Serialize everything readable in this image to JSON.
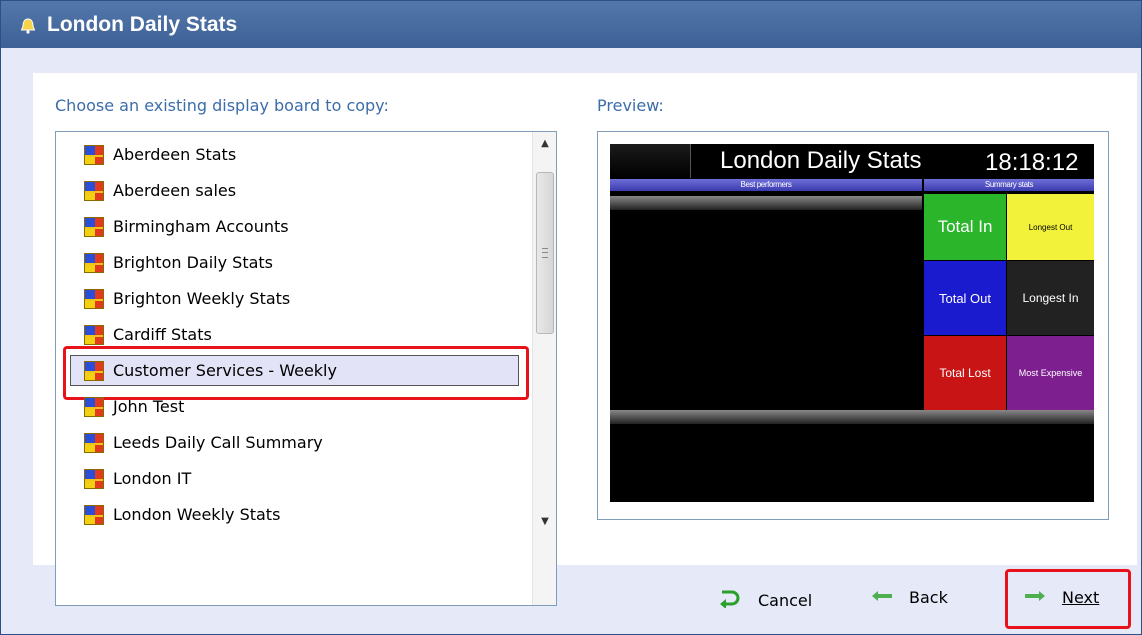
{
  "window": {
    "title": "London Daily Stats"
  },
  "copy_label": "Choose an existing display board to copy:",
  "preview_label": "Preview:",
  "boards": [
    {
      "label": "Aberdeen Stats"
    },
    {
      "label": "Aberdeen sales"
    },
    {
      "label": "Birmingham Accounts"
    },
    {
      "label": "Brighton Daily Stats"
    },
    {
      "label": "Brighton Weekly Stats"
    },
    {
      "label": "Cardiff Stats"
    },
    {
      "label": "Customer Services - Weekly"
    },
    {
      "label": "John Test"
    },
    {
      "label": "Leeds Daily Call Summary"
    },
    {
      "label": "London IT"
    },
    {
      "label": "London Weekly Stats"
    }
  ],
  "selected_board": "Customer Services - Weekly",
  "preview": {
    "title": "London Daily Stats",
    "clock": "18:18:12",
    "left_header": "Best performers",
    "right_header": "Summary stats",
    "tiles": {
      "total_in": "Total In",
      "longest_out": "Longest Out",
      "total_out": "Total Out",
      "longest_in": "Longest In",
      "total_lost": "Total Lost",
      "most_expensive": "Most Expensive"
    }
  },
  "buttons": {
    "cancel": "Cancel",
    "back": "Back",
    "next": "Next"
  },
  "colors": {
    "title_bar": "#3d6196",
    "label_text": "#3c6da8",
    "highlight": "#e8121b",
    "tile_total_in": "#2bb52b",
    "tile_longest_out": "#f2f23a",
    "tile_total_out": "#1a1acf",
    "tile_longest_in": "#222222",
    "tile_total_lost": "#c81414",
    "tile_most_expensive": "#7d1f8f"
  }
}
